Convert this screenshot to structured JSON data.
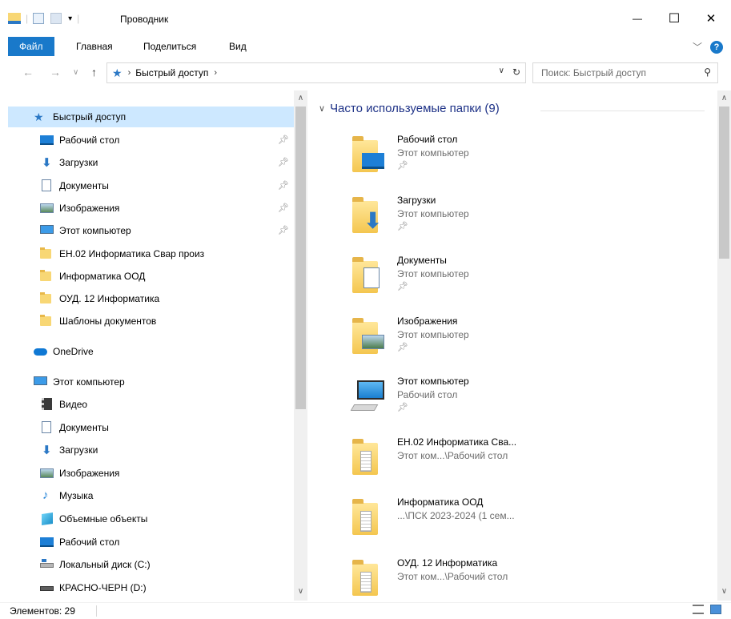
{
  "window": {
    "title": "Проводник",
    "minimize": "—",
    "maximize": "☐",
    "close": "✕"
  },
  "ribbon": {
    "tabs": [
      "Файл",
      "Главная",
      "Поделиться",
      "Вид"
    ],
    "help": "?"
  },
  "address": {
    "crumbs": [
      "Быстрый доступ"
    ],
    "search_placeholder": "Поиск: Быстрый доступ"
  },
  "nav": {
    "quick_access": "Быстрый доступ",
    "quick_items": [
      {
        "label": "Рабочий стол",
        "icon": "desktop-icon",
        "pinned": true
      },
      {
        "label": "Загрузки",
        "icon": "downloads-icon",
        "pinned": true
      },
      {
        "label": "Документы",
        "icon": "documents-icon",
        "pinned": true
      },
      {
        "label": "Изображения",
        "icon": "pictures-icon",
        "pinned": true
      },
      {
        "label": "Этот компьютер",
        "icon": "computer-icon",
        "pinned": true
      },
      {
        "label": "ЕН.02 Информатика Свар произ",
        "icon": "folder-icon",
        "pinned": false
      },
      {
        "label": "Информатика ООД",
        "icon": "folder-icon",
        "pinned": false
      },
      {
        "label": "ОУД. 12 Информатика",
        "icon": "folder-icon",
        "pinned": false
      },
      {
        "label": "Шаблоны документов",
        "icon": "folder-icon",
        "pinned": false
      }
    ],
    "onedrive": "OneDrive",
    "this_pc": "Этот компьютер",
    "pc_items": [
      {
        "label": "Видео",
        "icon": "video-icon"
      },
      {
        "label": "Документы",
        "icon": "documents-icon"
      },
      {
        "label": "Загрузки",
        "icon": "downloads-icon"
      },
      {
        "label": "Изображения",
        "icon": "pictures-icon"
      },
      {
        "label": "Музыка",
        "icon": "music-icon"
      },
      {
        "label": "Объемные объекты",
        "icon": "3d-objects-icon"
      },
      {
        "label": "Рабочий стол",
        "icon": "desktop-icon"
      },
      {
        "label": "Локальный диск (C:)",
        "icon": "local-disk-icon"
      },
      {
        "label": "КРАСНО-ЧЕРН (D:)",
        "icon": "drive-icon"
      }
    ]
  },
  "content": {
    "group_title": "Часто используемые папки (9)",
    "folders": [
      {
        "name": "Рабочий стол",
        "sub": "Этот компьютер",
        "icon": "desktop-folder-icon"
      },
      {
        "name": "Загрузки",
        "sub": "Этот компьютер",
        "icon": "downloads-folder-icon"
      },
      {
        "name": "Документы",
        "sub": "Этот компьютер",
        "icon": "documents-folder-icon"
      },
      {
        "name": "Изображения",
        "sub": "Этот компьютер",
        "icon": "pictures-folder-icon"
      },
      {
        "name": "Этот компьютер",
        "sub": "Рабочий стол",
        "icon": "computer-icon"
      },
      {
        "name": "ЕН.02 Информатика Сва...",
        "sub": "Этот ком...\\Рабочий стол",
        "icon": "folder-icon"
      },
      {
        "name": "Информатика ООД",
        "sub": "...\\ПСК 2023-2024 (1 сем...",
        "icon": "folder-icon"
      },
      {
        "name": "ОУД. 12 Информатика",
        "sub": "Этот ком...\\Рабочий стол",
        "icon": "folder-icon"
      }
    ]
  },
  "status": {
    "items_count": "Элементов: 29"
  },
  "colors": {
    "accent": "#1979ca",
    "selected": "#cde8ff",
    "group_title": "#1e3287",
    "folder": "#f8d775"
  }
}
